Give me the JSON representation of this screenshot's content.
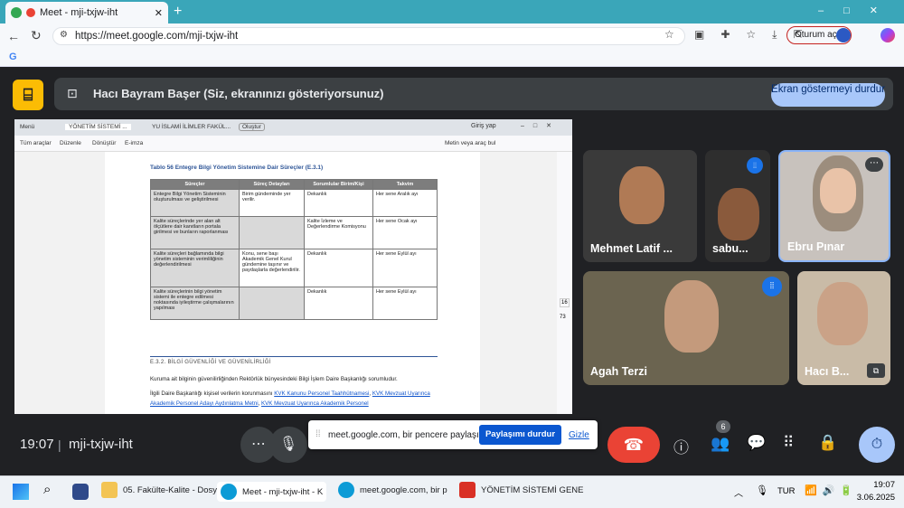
{
  "browser": {
    "tab_title": "Meet - mji-txjw-iht",
    "url": "https://meet.google.com/mji-txjw-iht",
    "profile_label": "Oturum aç"
  },
  "meet": {
    "banner_text": "Hacı Bayram Başer (Siz, ekranınızı gösteriyorsunuz)",
    "stop_presenting": "Ekran göstermeyi durdur",
    "time": "19:07",
    "code": "mji-txjw-iht",
    "people_count": "6",
    "participants": [
      {
        "name": "Mehmet Latif ..."
      },
      {
        "name": "sabu..."
      },
      {
        "name": "Ebru Pınar"
      },
      {
        "name": "Agah Terzi"
      },
      {
        "name": "Hacı B..."
      }
    ],
    "share_notice": "meet.google.com, bir pencere paylaşıyor.",
    "share_stop": "Paylaşımı durdur",
    "share_hide": "Gizle"
  },
  "doc": {
    "tabs": [
      "Menü",
      "YÖNETİM SİSTEMİ ...",
      "YU İSLAMİ İLİMLER FAKÜL...",
      "Oluştur"
    ],
    "signin": "Giriş yap",
    "tools": [
      "Tüm araçlar",
      "Düzenle",
      "Dönüştür",
      "E-imza"
    ],
    "search": "Metin veya araç bul",
    "table_title": "Tablo 56 Entegre Bilgi Yönetim Sistemine Dair Süreçler (E.3.1)",
    "headers": [
      "Süreçler",
      "Süreç Detayları",
      "Sorumlular Birim/Kişi",
      "Takvim"
    ],
    "rows": [
      [
        "Entegre Bilgi Yönetim Sisteminin oluşturulması ve geliştirilmesi",
        "Birim gündeminde yer verilir.",
        "Dekanlık",
        "Her sene Aralık ayı"
      ],
      [
        "Kalite süreçlerinde yer alan alt ölçütlere dair kanıtların portala girilmesi ve bunların raporlanması",
        "",
        "Kalite İzleme ve Değerlendirme Komisyonu",
        "Her sene Ocak ayı"
      ],
      [
        "Kalite süreçleri bağlamında bilgi yönetim sisteminin verimliliğinin değerlendirilmesi",
        "Konu, sene başı Akademik Genel Kurul gündemine taşınır ve paydaşlarla değerlendirilir.",
        "Dekanlık",
        "Her sene Eylül ayı"
      ],
      [
        "Kalite süreçlerinin bilgi yönetim sistemi ile entegre edilmesi noktasında iyileştirme çalışmalarının yapılması",
        "",
        "Dekanlık",
        "Her sene Eylül ayı"
      ]
    ],
    "section": "E.3.2. BİLGİ GÜVENLİĞİ VE GÜVENİLİRLİĞİ",
    "para1": "Kuruma ait bilginin güvenilirliğinden Rektörlük bünyesindeki Bilgi İşlem Daire Başkanlığı sorumludur.",
    "para2": "İlgili Daire Başkanlığı kişisel verilerin korunmasını",
    "link1": "KVK Kanunu Personel Taahhütnamesi",
    "link2": "KVK Mevzuat Uyarınca Akademik Personel Adayı Aydınlatma Metni",
    "link3": "KVK Mevzuat Uyarınca Akademik Personel",
    "page_num": "16",
    "page_total": "73"
  },
  "taskbar": {
    "items": [
      "05. Fakülte-Kalite - Dosy",
      "Meet - mji-txjw-iht - K",
      "meet.google.com, bir p",
      "YÖNETİM SİSTEMİ GENE"
    ],
    "lang": "TUR",
    "time": "19:07",
    "date": "3.06.2025"
  }
}
